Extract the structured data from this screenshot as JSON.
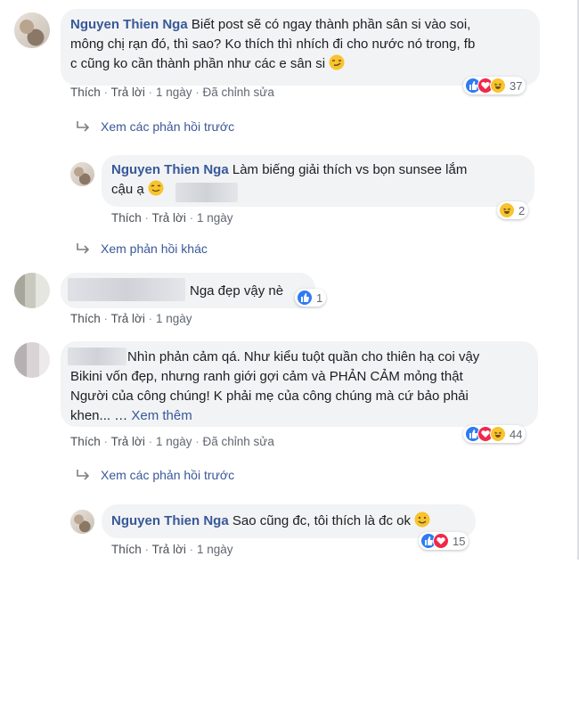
{
  "comments": [
    {
      "author": "Nguyen Thien Nga",
      "text_l1": "Biết post sẽ có ngay thành phần sân si vào soi,",
      "text_l2": "mông chị rạn đó, thì sao? Ko thích thì nhích đi cho nước nó trong, fb",
      "text_l3": "c cũng ko cần thành phần như các e sân si",
      "like": "Thích",
      "reply": "Trả lời",
      "time": "1 ngày",
      "edited": "Đã chỉnh sửa",
      "reaction_count": "37"
    },
    {
      "prev_replies": "Xem các phản hồi trước"
    },
    {
      "author": "Nguyen Thien Nga",
      "text_l1": "Làm biếng giải thích vs bọn sunsee lắm",
      "text_l2": "cậu ạ",
      "like": "Thích",
      "reply": "Trả lời",
      "time": "1 ngày",
      "reaction_count": "2"
    },
    {
      "more_replies": "Xem phản hồi khác"
    },
    {
      "text": "Nga đẹp vậy nè",
      "like": "Thích",
      "reply": "Trả lời",
      "time": "1 ngày",
      "reaction_count": "1"
    },
    {
      "text_l1": "Nhìn phản cảm qá. Như kiểu tuột quần cho thiên hạ coi vậy",
      "text_l2": "Bikini vốn đẹp, nhưng ranh giới gợi cảm và PHẢN CẢM mỏng thật",
      "text_l3": "Người của công chúng! K phải mẹ của công chúng mà cứ bảo phải",
      "text_l4": "khen... …",
      "see_more": "Xem thêm",
      "like": "Thích",
      "reply": "Trả lời",
      "time": "1 ngày",
      "edited": "Đã chỉnh sửa",
      "reaction_count": "44"
    },
    {
      "prev_replies": "Xem các phản hồi trước"
    },
    {
      "author": "Nguyen Thien Nga",
      "text": "Sao cũng đc, tôi thích là đc ok",
      "like": "Thích",
      "reply": "Trả lời",
      "time": "1 ngày",
      "reaction_count": "15"
    }
  ],
  "icons": [
    "like-icon",
    "love-icon",
    "haha-icon",
    "reply-arrow-icon",
    "smirk-emoji",
    "blush-emoji",
    "smile-emoji"
  ],
  "colors": {
    "name": "#385898",
    "bubble": "#f2f3f5",
    "like": "#2e7bf2",
    "love": "#f0284a",
    "haha": "#f7c42d"
  }
}
